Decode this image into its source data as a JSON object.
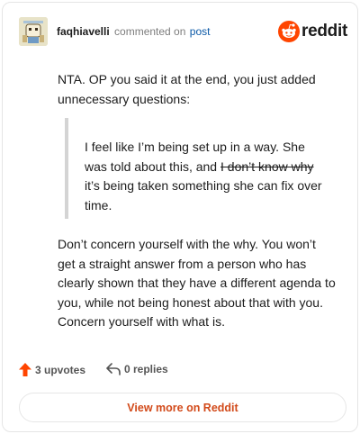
{
  "header": {
    "author": "faqhiavelli",
    "action": "commented on",
    "post_link": "post",
    "brand": "reddit"
  },
  "comment": {
    "intro": "NTA. OP you said it at the end, you just added unnecessary questions:",
    "quote_before": "I feel like I’m being set up in a way. She was told about this, and ",
    "quote_strike": "I don’t know why",
    "quote_after": " it’s being taken something she can fix over time.",
    "body": "Don’t concern yourself with the why. You won’t get a straight answer from a person who has clearly shown that they have a different agenda to you, while not being honest about that with you. Concern yourself with what is."
  },
  "footer": {
    "upvotes": "3 upvotes",
    "replies": "0 replies",
    "view_more": "View more on Reddit"
  },
  "colors": {
    "accent": "#ff4500",
    "link": "#0a58a6",
    "view_more_text": "#d24a1a"
  },
  "icons": [
    "avatar",
    "reddit-logo-icon",
    "upvote-arrow-icon",
    "reply-icon"
  ]
}
